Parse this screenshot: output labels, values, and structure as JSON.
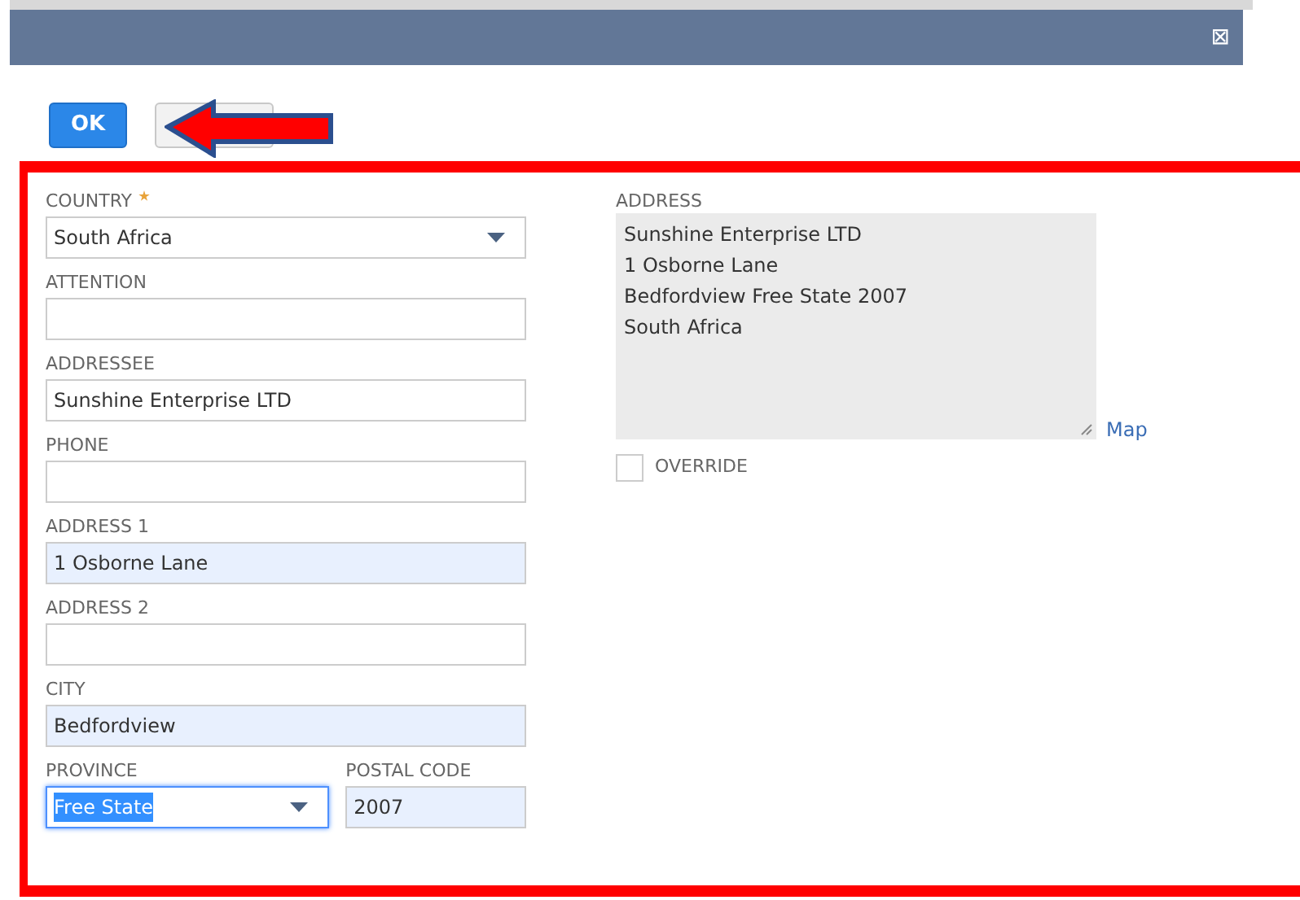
{
  "dialog": {
    "close_icon": "⊠"
  },
  "buttons": [
    {
      "kind": "primary",
      "label": "OK"
    },
    {
      "kind": "secondary"
    }
  ],
  "left_fields": [
    {
      "label": "COUNTRY",
      "required": true,
      "kind": "select",
      "value": "South Africa",
      "autofilled": false,
      "focused": false
    },
    {
      "label": "ATTENTION",
      "required": false,
      "kind": "text",
      "autofilled": false,
      "focused": false
    },
    {
      "label": "ADDRESSEE",
      "required": false,
      "kind": "text",
      "value": "Sunshine Enterprise LTD",
      "autofilled": false,
      "focused": false
    },
    {
      "label": "PHONE",
      "required": false,
      "kind": "text",
      "autofilled": false,
      "focused": false
    },
    {
      "label": "ADDRESS 1",
      "required": false,
      "kind": "text",
      "value": "1 Osborne Lane",
      "autofilled": true,
      "focused": false
    },
    {
      "label": "ADDRESS 2",
      "required": false,
      "kind": "text",
      "autofilled": false,
      "focused": false
    },
    {
      "label": "CITY",
      "required": false,
      "kind": "text",
      "value": "Bedfordview",
      "autofilled": true,
      "focused": false
    }
  ],
  "bottom_fields": [
    {
      "label": "PROVINCE",
      "kind": "select",
      "value": "Free State",
      "autofilled": false,
      "focused": true
    },
    {
      "label": "POSTAL CODE",
      "kind": "text",
      "value": "2007",
      "autofilled": true,
      "focused": false
    }
  ],
  "address": {
    "label": "ADDRESS",
    "lines": [
      "Sunshine Enterprise LTD",
      "1 Osborne Lane",
      "Bedfordview Free State 2007",
      "South Africa"
    ],
    "map_link": "Map"
  },
  "override": {
    "label": "OVERRIDE",
    "checked": false
  }
}
